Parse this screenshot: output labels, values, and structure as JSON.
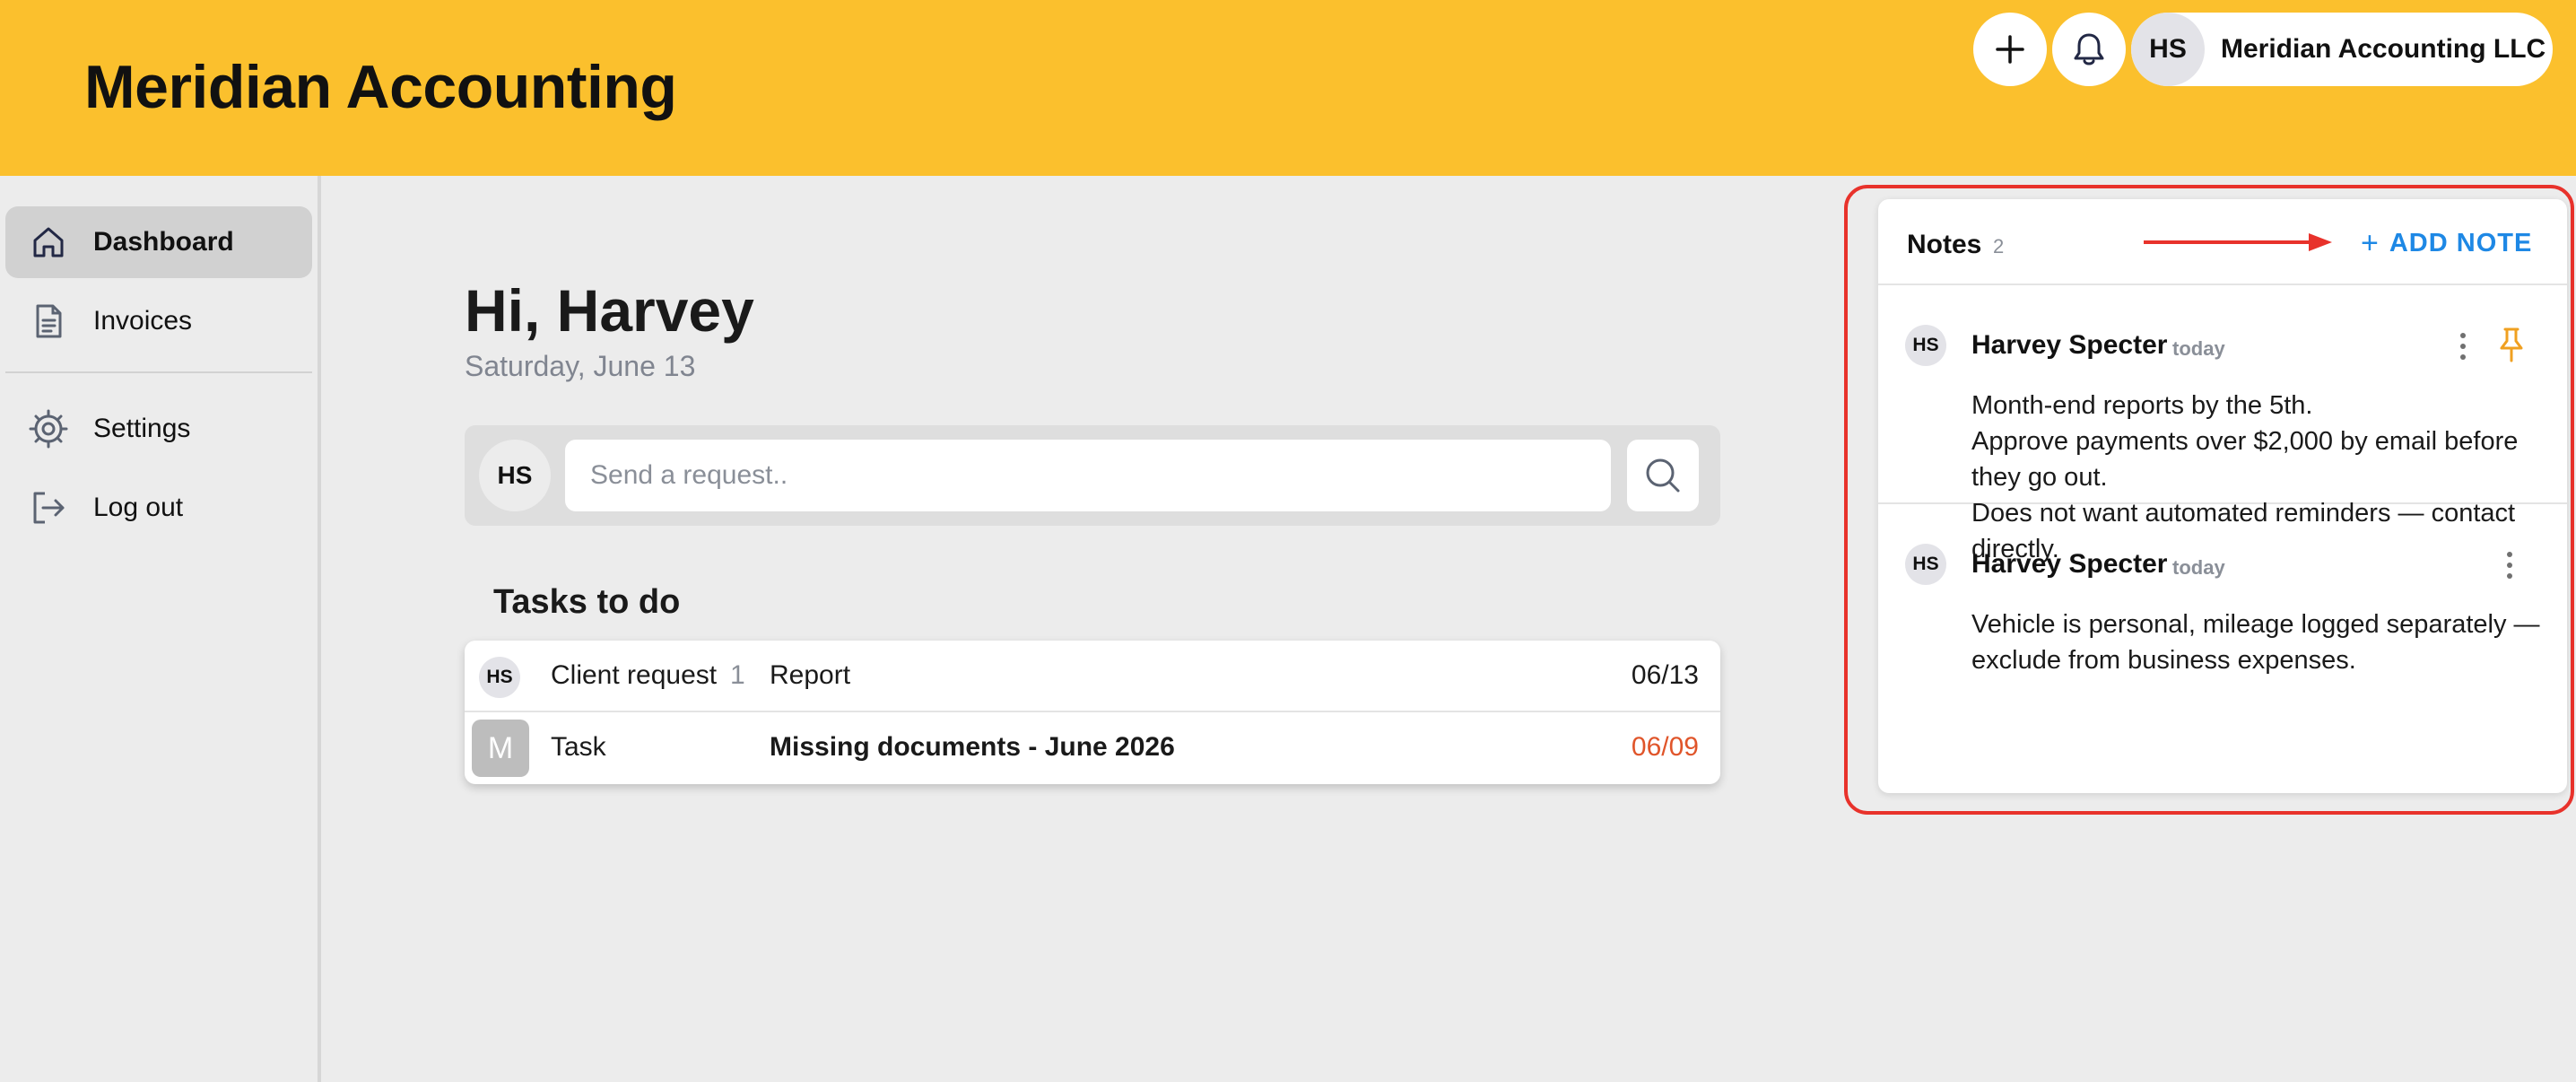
{
  "header": {
    "brand": "Meridian Accounting",
    "account_initials": "HS",
    "account_name": "Meridian Accounting LLC"
  },
  "sidebar": {
    "items": [
      {
        "label": "Dashboard",
        "icon": "home-icon",
        "active": true
      },
      {
        "label": "Invoices",
        "icon": "document-icon"
      },
      {
        "label": "Settings",
        "icon": "gear-icon"
      },
      {
        "label": "Log out",
        "icon": "logout-icon"
      }
    ]
  },
  "main": {
    "greeting": "Hi, Harvey",
    "date": "Saturday, June 13",
    "request": {
      "avatar": "HS",
      "placeholder": "Send a request.."
    },
    "tasks": {
      "title": "Tasks to do",
      "rows": [
        {
          "avatar": "HS",
          "type": "Client request",
          "count": "1",
          "description": "Report",
          "date": "06/13"
        },
        {
          "avatar": "M",
          "type": "Task",
          "description": "Missing documents - June 2026",
          "date": "06/09"
        }
      ]
    }
  },
  "notes": {
    "title": "Notes",
    "count": "2",
    "add_label": "ADD NOTE",
    "items": [
      {
        "avatar": "HS",
        "author": "Harvey Specter",
        "when": "today",
        "lines": [
          "Month-end reports by the 5th.",
          "Approve payments over $2,000 by email before they go out.",
          "Does not want automated reminders — contact directly."
        ]
      },
      {
        "avatar": "HS",
        "author": "Harvey Specter",
        "when": "today",
        "lines": [
          "Vehicle is personal, mileage logged separately — exclude from business expenses."
        ]
      }
    ]
  },
  "colors": {
    "header": "#fbc02d",
    "accent": "#1e88e5",
    "overdue": "#e0552a",
    "pin": "#f0a020",
    "highlight": "#e8322b"
  }
}
